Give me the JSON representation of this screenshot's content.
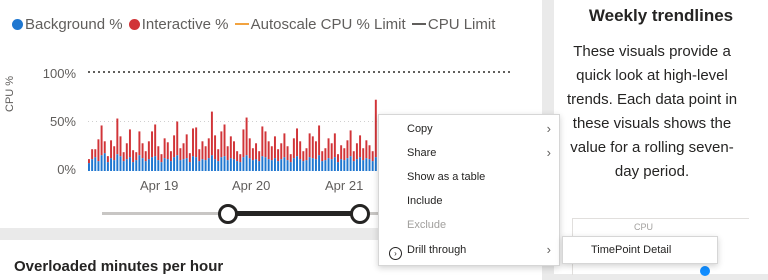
{
  "legend": {
    "items": [
      {
        "label": "Background %",
        "color": "#1f77d0",
        "marker": "dot"
      },
      {
        "label": "Interactive %",
        "color": "#d13438",
        "marker": "dot"
      },
      {
        "label": "Autoscale CPU % Limit",
        "color": "#f2a340",
        "marker": "dash"
      },
      {
        "label": "CPU Limit",
        "color": "#605e5c",
        "marker": "dash"
      }
    ]
  },
  "chart": {
    "y_axis_title": "CPU %",
    "y_ticks": [
      "100%",
      "50%",
      "0%"
    ],
    "x_ticks": [
      "Apr 19",
      "Apr 20",
      "Apr 21"
    ]
  },
  "chart_data": {
    "type": "bar",
    "xlabel": "",
    "ylabel": "CPU %",
    "ylim": [
      0,
      100
    ],
    "cpu_limit": 100,
    "series": [
      {
        "name": "Background %",
        "color": "#1f77d0",
        "values": [
          8,
          12,
          14,
          10,
          16,
          18,
          9,
          13,
          11,
          17,
          15,
          10,
          12,
          14,
          9,
          11,
          16,
          13,
          10,
          12,
          14,
          15,
          11,
          9,
          13,
          12,
          10,
          14,
          16,
          11,
          12,
          13,
          9,
          15,
          14,
          10,
          12,
          11,
          13,
          16,
          12,
          10,
          14,
          15,
          11,
          13,
          12,
          10,
          9,
          14,
          16,
          13,
          11,
          12,
          10,
          15,
          14,
          12,
          11,
          13,
          10,
          12,
          14,
          11,
          9,
          13,
          15,
          12,
          10,
          11,
          14,
          13,
          12,
          16,
          10,
          11,
          13,
          12,
          14,
          9,
          12,
          11,
          13,
          15,
          10,
          12,
          14,
          11,
          13,
          12,
          10,
          14
        ]
      },
      {
        "name": "Interactive %",
        "color": "#d13438",
        "values": [
          4,
          10,
          8,
          22,
          30,
          12,
          6,
          18,
          14,
          36,
          20,
          9,
          16,
          28,
          12,
          8,
          24,
          15,
          10,
          18,
          26,
          32,
          14,
          8,
          20,
          17,
          10,
          22,
          34,
          12,
          16,
          24,
          9,
          28,
          30,
          12,
          18,
          14,
          20,
          44,
          24,
          12,
          26,
          32,
          14,
          22,
          18,
          10,
          8,
          28,
          38,
          20,
          12,
          16,
          10,
          30,
          26,
          18,
          14,
          22,
          12,
          16,
          24,
          14,
          8,
          20,
          28,
          18,
          10,
          12,
          24,
          22,
          18,
          30,
          10,
          12,
          20,
          16,
          24,
          8,
          14,
          12,
          18,
          26,
          10,
          16,
          22,
          12,
          18,
          14,
          10,
          58
        ]
      }
    ]
  },
  "slider": {
    "start": 0.46,
    "end": 0.94
  },
  "context_menu": {
    "items": [
      {
        "label": "Copy",
        "enabled": true,
        "has_submenu": true
      },
      {
        "label": "Share",
        "enabled": true,
        "has_submenu": true
      },
      {
        "label": "Show as a table",
        "enabled": true,
        "has_submenu": false
      },
      {
        "label": "Include",
        "enabled": true,
        "has_submenu": false
      },
      {
        "label": "Exclude",
        "enabled": false,
        "has_submenu": false
      },
      {
        "label": "Drill through",
        "enabled": true,
        "has_submenu": true
      }
    ],
    "chevron": "›",
    "drill_icon": "drill-through-icon"
  },
  "submenu": {
    "items": [
      {
        "label": "TimePoint Detail"
      }
    ]
  },
  "trendlines": {
    "title": "Weekly trendlines",
    "body": "These visuals provide a quick look at high-level trends. Each data point in these visuals shows the value for a rolling seven-day period.",
    "mini_label": "CPU"
  },
  "overload": {
    "title": "Overloaded minutes per hour"
  }
}
